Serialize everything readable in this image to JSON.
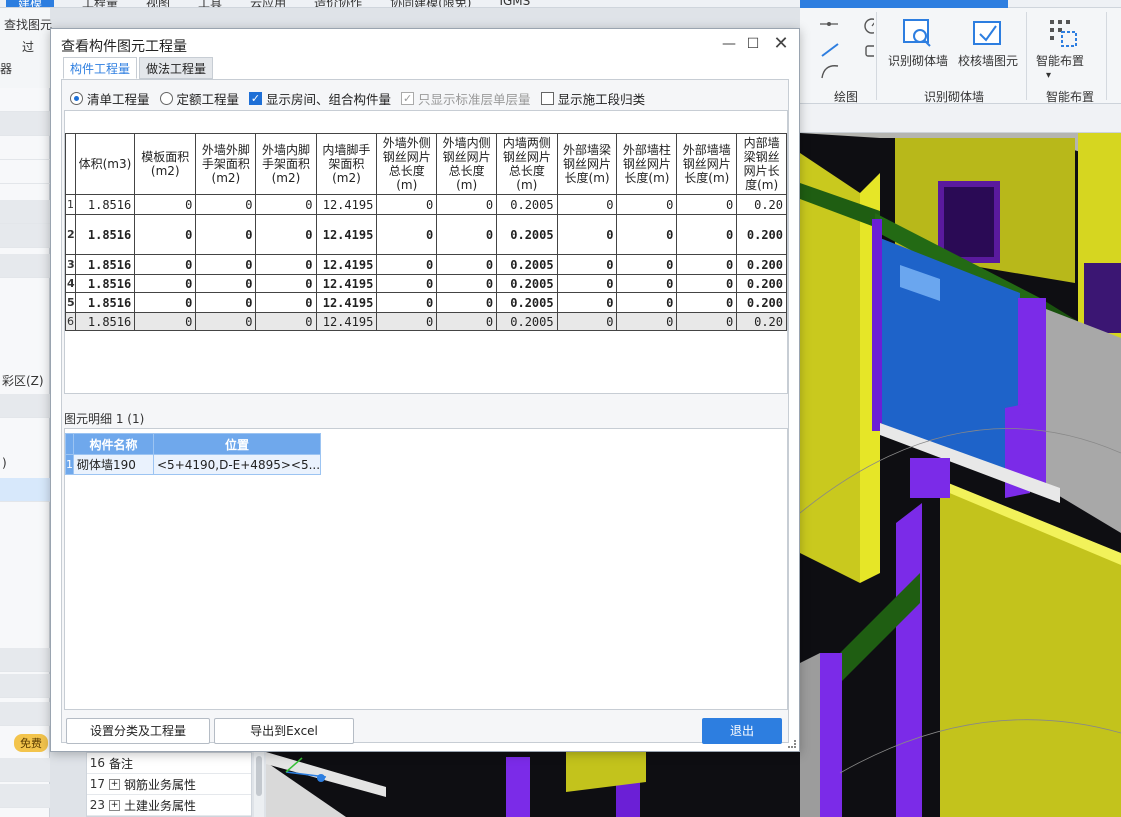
{
  "background": {
    "ribbon_tabs": [
      "建模",
      "工程量",
      "视图",
      "工具",
      "云应用",
      "造价协作",
      "协同建模(限免)",
      "IGMS"
    ],
    "left_ribbon": [
      "查找图元",
      "过",
      "器"
    ],
    "left_panel": [
      "彩区(Z)",
      ")",
      "免费"
    ],
    "prop_rows": [
      {
        "num": "16",
        "label": "备注",
        "expandable": false
      },
      {
        "num": "17",
        "label": "钢筋业务属性",
        "expandable": true
      },
      {
        "num": "23",
        "label": "土建业务属性",
        "expandable": true
      }
    ],
    "ribbon_right": {
      "draw_group": "绘图",
      "identify_wall": "识别砌体墙",
      "check_wall": "校核墙图元",
      "smart_layout": "智能布置",
      "group_identify": "识别砌体墙",
      "group_smart": "智能布置"
    }
  },
  "dialog": {
    "title": "查看构件图元工程量",
    "tabs": [
      "构件工程量",
      "做法工程量"
    ],
    "options": {
      "bill_qty": "清单工程量",
      "quota_qty": "定额工程量",
      "show_room": "显示房间、组合构件量",
      "only_std_floor": "只显示标准层单层量",
      "show_section": "显示施工段归类"
    },
    "table": {
      "headers": [
        "体积(m3)",
        "模板面积(m2)",
        "外墙外脚手架面积(m2)",
        "外墙内脚手架面积(m2)",
        "内墙脚手架面积(m2)",
        "外墙外侧钢丝网片总长度(m)",
        "外墙内侧钢丝网片总长度(m)",
        "内墙两侧钢丝网片总长度(m)",
        "外部墙梁钢丝网片长度(m)",
        "外部墙柱钢丝网片长度(m)",
        "外部墙墙钢丝网片长度(m)",
        "内部墙梁钢丝网片长度(m)"
      ],
      "rows": [
        {
          "n": "1",
          "style": "normal",
          "cells": [
            "1.8516",
            "0",
            "0",
            "0",
            "12.4195",
            "0",
            "0",
            "0.2005",
            "0",
            "0",
            "0",
            "0.20"
          ]
        },
        {
          "n": "2",
          "style": "bold",
          "cells": [
            "1.8516",
            "0",
            "0",
            "0",
            "12.4195",
            "0",
            "0",
            "0.2005",
            "0",
            "0",
            "0",
            "0.200"
          ]
        },
        {
          "n": "3",
          "style": "bold",
          "cells": [
            "1.8516",
            "0",
            "0",
            "0",
            "12.4195",
            "0",
            "0",
            "0.2005",
            "0",
            "0",
            "0",
            "0.200"
          ]
        },
        {
          "n": "4",
          "style": "bold",
          "cells": [
            "1.8516",
            "0",
            "0",
            "0",
            "12.4195",
            "0",
            "0",
            "0.2005",
            "0",
            "0",
            "0",
            "0.200"
          ]
        },
        {
          "n": "5",
          "style": "bold",
          "cells": [
            "1.8516",
            "0",
            "0",
            "0",
            "12.4195",
            "0",
            "0",
            "0.2005",
            "0",
            "0",
            "0",
            "0.200"
          ]
        },
        {
          "n": "6",
          "style": "gray",
          "cells": [
            "1.8516",
            "0",
            "0",
            "0",
            "12.4195",
            "0",
            "0",
            "0.2005",
            "0",
            "0",
            "0",
            "0.20"
          ]
        }
      ]
    },
    "detail": {
      "label": "图元明细  1 (1)",
      "headers": [
        "构件名称",
        "位置"
      ],
      "rows": [
        {
          "n": "1",
          "name": "砌体墙190",
          "position": "<5+4190,D-E+4895><5..."
        }
      ]
    },
    "buttons": {
      "settings": "设置分类及工程量",
      "export": "导出到Excel",
      "exit": "退出"
    }
  }
}
